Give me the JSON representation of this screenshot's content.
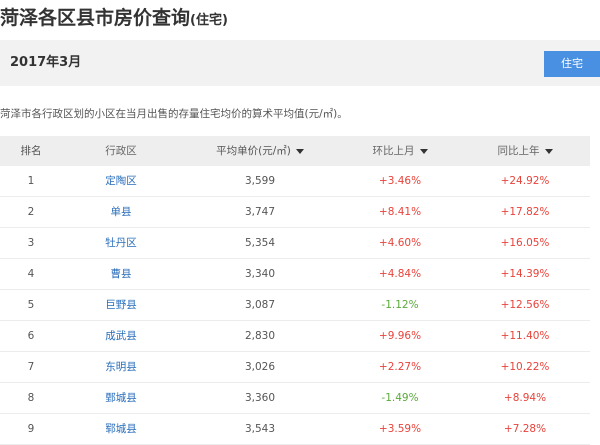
{
  "page": {
    "title": "菏泽各区县市房价查询",
    "title_sub": "(住宅)"
  },
  "header": {
    "month": "2017年3月",
    "type_button": "住宅"
  },
  "description": "菏泽市各行政区划的小区在当月出售的存量住宅均价的算术平均值(元/㎡)。",
  "colors": {
    "up": "#e8433b",
    "down": "#5aaa3a",
    "link": "#2a6ebb",
    "accent": "#4a90e2"
  },
  "table": {
    "headers": {
      "rank": "排名",
      "district": "行政区",
      "price": "平均单价(元/㎡)",
      "mom": "环比上月",
      "yoy": "同比上年"
    },
    "rows": [
      {
        "rank": "1",
        "district": "定陶区",
        "price": "3,599",
        "mom": "+3.46%",
        "yoy": "+24.92%"
      },
      {
        "rank": "2",
        "district": "单县",
        "price": "3,747",
        "mom": "+8.41%",
        "yoy": "+17.82%"
      },
      {
        "rank": "3",
        "district": "牡丹区",
        "price": "5,354",
        "mom": "+4.60%",
        "yoy": "+16.05%"
      },
      {
        "rank": "4",
        "district": "曹县",
        "price": "3,340",
        "mom": "+4.84%",
        "yoy": "+14.39%"
      },
      {
        "rank": "5",
        "district": "巨野县",
        "price": "3,087",
        "mom": "-1.12%",
        "yoy": "+12.56%"
      },
      {
        "rank": "6",
        "district": "成武县",
        "price": "2,830",
        "mom": "+9.96%",
        "yoy": "+11.40%"
      },
      {
        "rank": "7",
        "district": "东明县",
        "price": "3,026",
        "mom": "+2.27%",
        "yoy": "+10.22%"
      },
      {
        "rank": "8",
        "district": "鄄城县",
        "price": "3,360",
        "mom": "-1.49%",
        "yoy": "+8.94%"
      },
      {
        "rank": "9",
        "district": "郓城县",
        "price": "3,543",
        "mom": "+3.59%",
        "yoy": "+7.28%"
      }
    ]
  }
}
